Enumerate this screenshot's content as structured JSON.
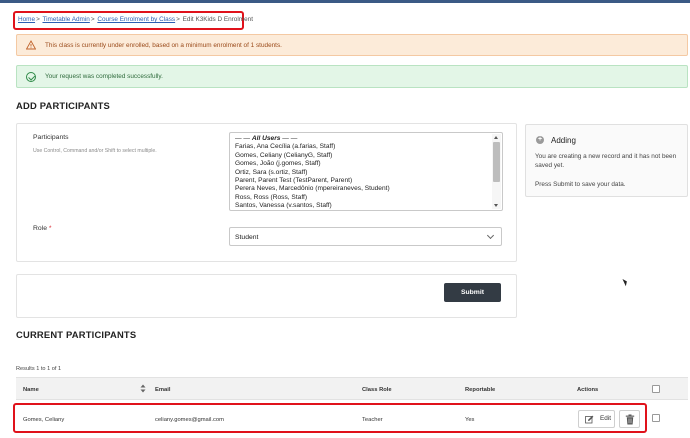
{
  "breadcrumb": {
    "items": [
      "Home",
      "Timetable Admin",
      "Course Enrolment by Class"
    ],
    "current": "Edit K3Kids D Enrolment",
    "separator": ">"
  },
  "alerts": {
    "warning": "This class is currently under enrolled, based on a minimum enrolment of 1 students.",
    "success": "Your request was completed successfully."
  },
  "add_participants": {
    "heading": "ADD PARTICIPANTS",
    "participants_label": "Participants",
    "participants_hint": "Use Control, Command and/or Shift to select multiple.",
    "group_label": "All Users",
    "options": [
      "Farias, Ana Cecília (a.farias, Staff)",
      "Gomes, Celiany (CelianyG, Staff)",
      "Gomes, João (j.gomes, Staff)",
      "Ortiz, Sara (s.ortiz, Staff)",
      "Parent, Parent Test (TestParent, Parent)",
      "Perera Neves, Marcedônio (mpereiraneves, Student)",
      "Ross, Ross (Ross, Staff)",
      "Santos, Vanessa (v.santos, Staff)"
    ],
    "role_label": "Role",
    "role_required": "*",
    "role_value": "Student",
    "submit_label": "Submit"
  },
  "info_box": {
    "title": "Adding",
    "line1": "You are creating a new record and it has not been saved yet.",
    "line2": "Press Submit to save your data."
  },
  "current_participants": {
    "heading": "CURRENT PARTICIPANTS",
    "results": "Results 1 to 1 of 1",
    "columns": {
      "name": "Name",
      "email": "Email",
      "class_role": "Class Role",
      "reportable": "Reportable",
      "actions": "Actions"
    },
    "rows": [
      {
        "name": "Gomes, Celiany",
        "email": "celiany.gomes@gmail.com",
        "class_role": "Teacher",
        "reportable": "Yes",
        "edit_label": "Edit"
      }
    ]
  },
  "colors": {
    "highlight": "#e0121b",
    "link": "#2b5fb3",
    "submit_bg": "#333b44"
  }
}
